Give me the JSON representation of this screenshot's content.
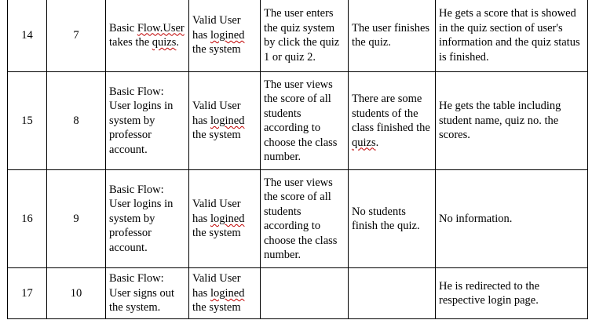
{
  "table": {
    "rows": [
      {
        "no": "14",
        "id": "7",
        "flow": [
          "Basic ",
          {
            "text": "Flow.User",
            "wavy": true
          },
          " takes the ",
          {
            "text": "quizs",
            "wavy": true
          },
          "."
        ],
        "precondition": [
          "Valid User has ",
          {
            "text": "logined",
            "wavy": true
          },
          " the system"
        ],
        "action": [
          "The user enters the quiz system by click the quiz 1 or quiz 2."
        ],
        "condition": [
          "The user finishes the quiz."
        ],
        "result": [
          "He gets a score that is showed in the quiz section of user's information and the quiz status is finished."
        ]
      },
      {
        "no": "15",
        "id": "8",
        "flow": [
          "Basic Flow: User logins in system by professor account."
        ],
        "precondition": [
          "Valid User has ",
          {
            "text": "logined",
            "wavy": true
          },
          " the system"
        ],
        "action": [
          "The user views the score of all students according to choose the class number."
        ],
        "condition": [
          "There are some students of the class finished the ",
          {
            "text": "quizs",
            "wavy": true
          },
          "."
        ],
        "result": [
          "He gets the table including student name, quiz no. the scores."
        ]
      },
      {
        "no": "16",
        "id": "9",
        "flow": [
          "Basic Flow: User logins in system by professor account."
        ],
        "precondition": [
          "Valid User has ",
          {
            "text": "logined",
            "wavy": true
          },
          " the system"
        ],
        "action": [
          "The user views the score of all students according to choose the class number."
        ],
        "condition": [
          "No students finish the quiz."
        ],
        "result": [
          "No information."
        ]
      },
      {
        "no": "17",
        "id": "10",
        "flow": [
          "Basic Flow: User signs out the system."
        ],
        "precondition": [
          "Valid User has ",
          {
            "text": "logined",
            "wavy": true
          },
          " the system"
        ],
        "action": [
          ""
        ],
        "condition": [
          ""
        ],
        "result": [
          "He is redirected to the respective login page."
        ]
      }
    ]
  }
}
